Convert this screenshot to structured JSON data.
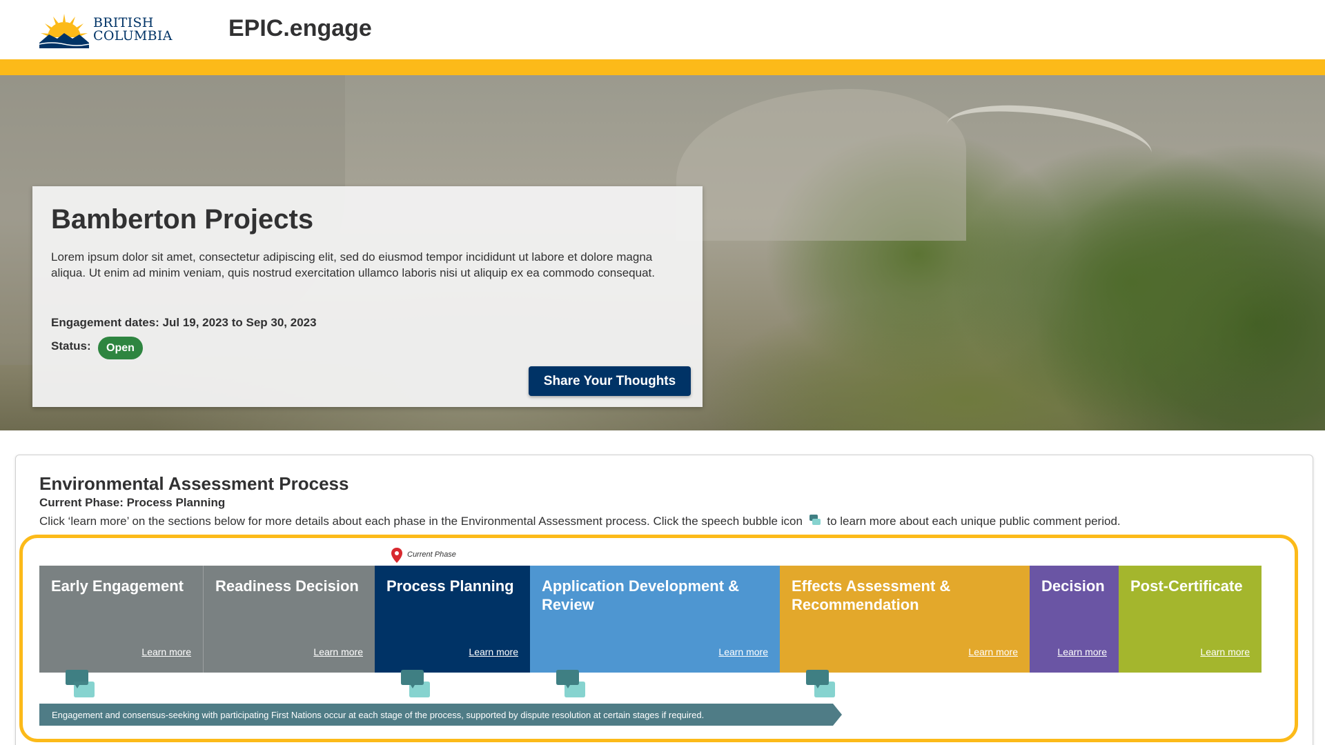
{
  "header": {
    "logo_line1": "BRITISH",
    "logo_line2": "COLUMBIA",
    "app_title": "EPIC.engage"
  },
  "hero": {
    "title": "Bamberton Projects",
    "description": "Lorem ipsum dolor sit amet, consectetur adipiscing elit, sed do eiusmod tempor incididunt ut labore et dolore magna aliqua. Ut enim ad minim veniam, quis nostrud exercitation ullamco laboris nisi ut aliquip ex ea commodo consequat.",
    "engagement_dates": "Engagement dates: Jul 19, 2023 to Sep 30, 2023",
    "status_label": "Status:",
    "status_value": "Open",
    "cta_label": "Share Your Thoughts"
  },
  "ea_process": {
    "title": "Environmental Assessment Process",
    "current_phase": "Current Phase: Process Planning",
    "help_text_before": "Click ‘learn more’ on the sections below for more details about each phase in the Environmental Assessment process. Click the speech bubble icon",
    "help_text_after": "to learn more about each unique public comment period.",
    "current_marker_label": "Current Phase",
    "phases": [
      {
        "name": "Early Engagement",
        "link": "Learn more",
        "color": "#7a8182"
      },
      {
        "name": "Readiness Decision",
        "link": "Learn more",
        "color": "#7a8182"
      },
      {
        "name": "Process Planning",
        "link": "Learn more",
        "color": "#003366"
      },
      {
        "name": "Application Development & Review",
        "link": "Learn more",
        "color": "#4e96d1"
      },
      {
        "name": "Effects Assessment & Recommendation",
        "link": "Learn more",
        "color": "#e3a82b"
      },
      {
        "name": "Decision",
        "link": "Learn more",
        "color": "#6a55a4"
      },
      {
        "name": "Post-Certificate",
        "link": "Learn more",
        "color": "#a4b62d"
      }
    ],
    "first_nations_banner": "Engagement and consensus-seeking with participating First Nations occur at each stage of the process, supported by dispute resolution at certain stages if required."
  },
  "colors": {
    "bc_blue": "#003366",
    "bc_gold": "#fcba19",
    "status_green": "#2e8540",
    "banner_teal": "#4f7c86",
    "bubble_dark": "#3f7f83",
    "bubble_light": "#86d3cf"
  }
}
